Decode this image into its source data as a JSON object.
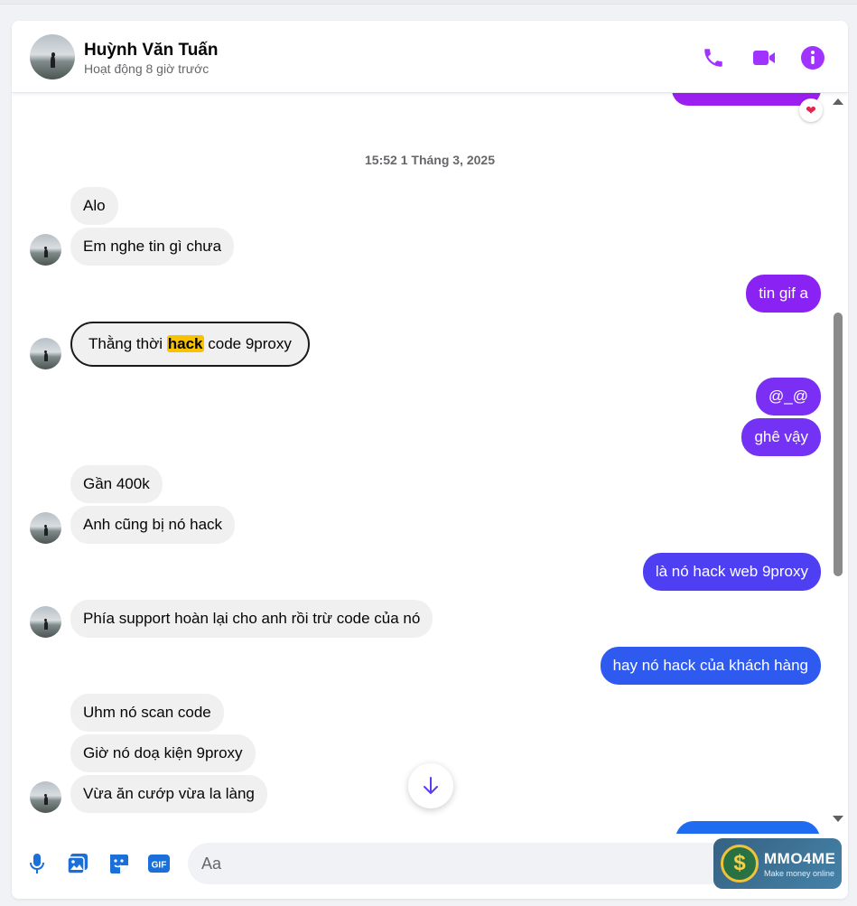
{
  "contact": {
    "name": "Huỳnh Văn Tuấn",
    "status": "Hoạt động 8 giờ trước"
  },
  "colors": {
    "accent": "#a033ff",
    "outgoing_top": "#9b1ff0",
    "outgoing_mid": "#6a3cf5",
    "outgoing_bottom": "#2a5cf0",
    "incoming_bg": "#f0f0f0",
    "highlight": "#f7c200"
  },
  "icons": {
    "call": "phone-icon",
    "video": "video-camera-icon",
    "info": "info-icon",
    "mic": "microphone-icon",
    "image": "image-icon",
    "sticker": "sticker-icon",
    "gif": "gif-icon",
    "scroll_down": "arrow-down-icon",
    "reaction": "heart-icon"
  },
  "conversation": {
    "timestamp": "15:52 1 Tháng 3, 2025",
    "messages": [
      {
        "from": "them",
        "text": "Alo"
      },
      {
        "from": "them",
        "text": "Em nghe tin gì chưa"
      },
      {
        "from": "me",
        "text": "tin gif a"
      },
      {
        "from": "them",
        "text_before": "Thằng thời ",
        "highlight": "hack",
        "text_after": " code 9proxy"
      },
      {
        "from": "me",
        "text": "@_@"
      },
      {
        "from": "me",
        "text": "ghê vậy"
      },
      {
        "from": "them",
        "text": "Gần 400k"
      },
      {
        "from": "them",
        "text": "Anh cũng bị nó hack"
      },
      {
        "from": "me",
        "text": "là nó hack web 9proxy"
      },
      {
        "from": "them",
        "text": "Phía support hoàn lại cho anh rồi trừ code của nó"
      },
      {
        "from": "me",
        "text": "hay nó hack của khách hàng"
      },
      {
        "from": "them",
        "text": "Uhm nó scan code"
      },
      {
        "from": "them",
        "text": "Giờ nó doạ kiện 9proxy"
      },
      {
        "from": "them",
        "text": "Vừa ăn cướp vừa la làng"
      }
    ]
  },
  "composer": {
    "placeholder": "Aa",
    "gif_label": "GIF"
  },
  "watermark": {
    "brand": "MMO4ME",
    "tagline": "Make money online",
    "symbol": "$"
  }
}
